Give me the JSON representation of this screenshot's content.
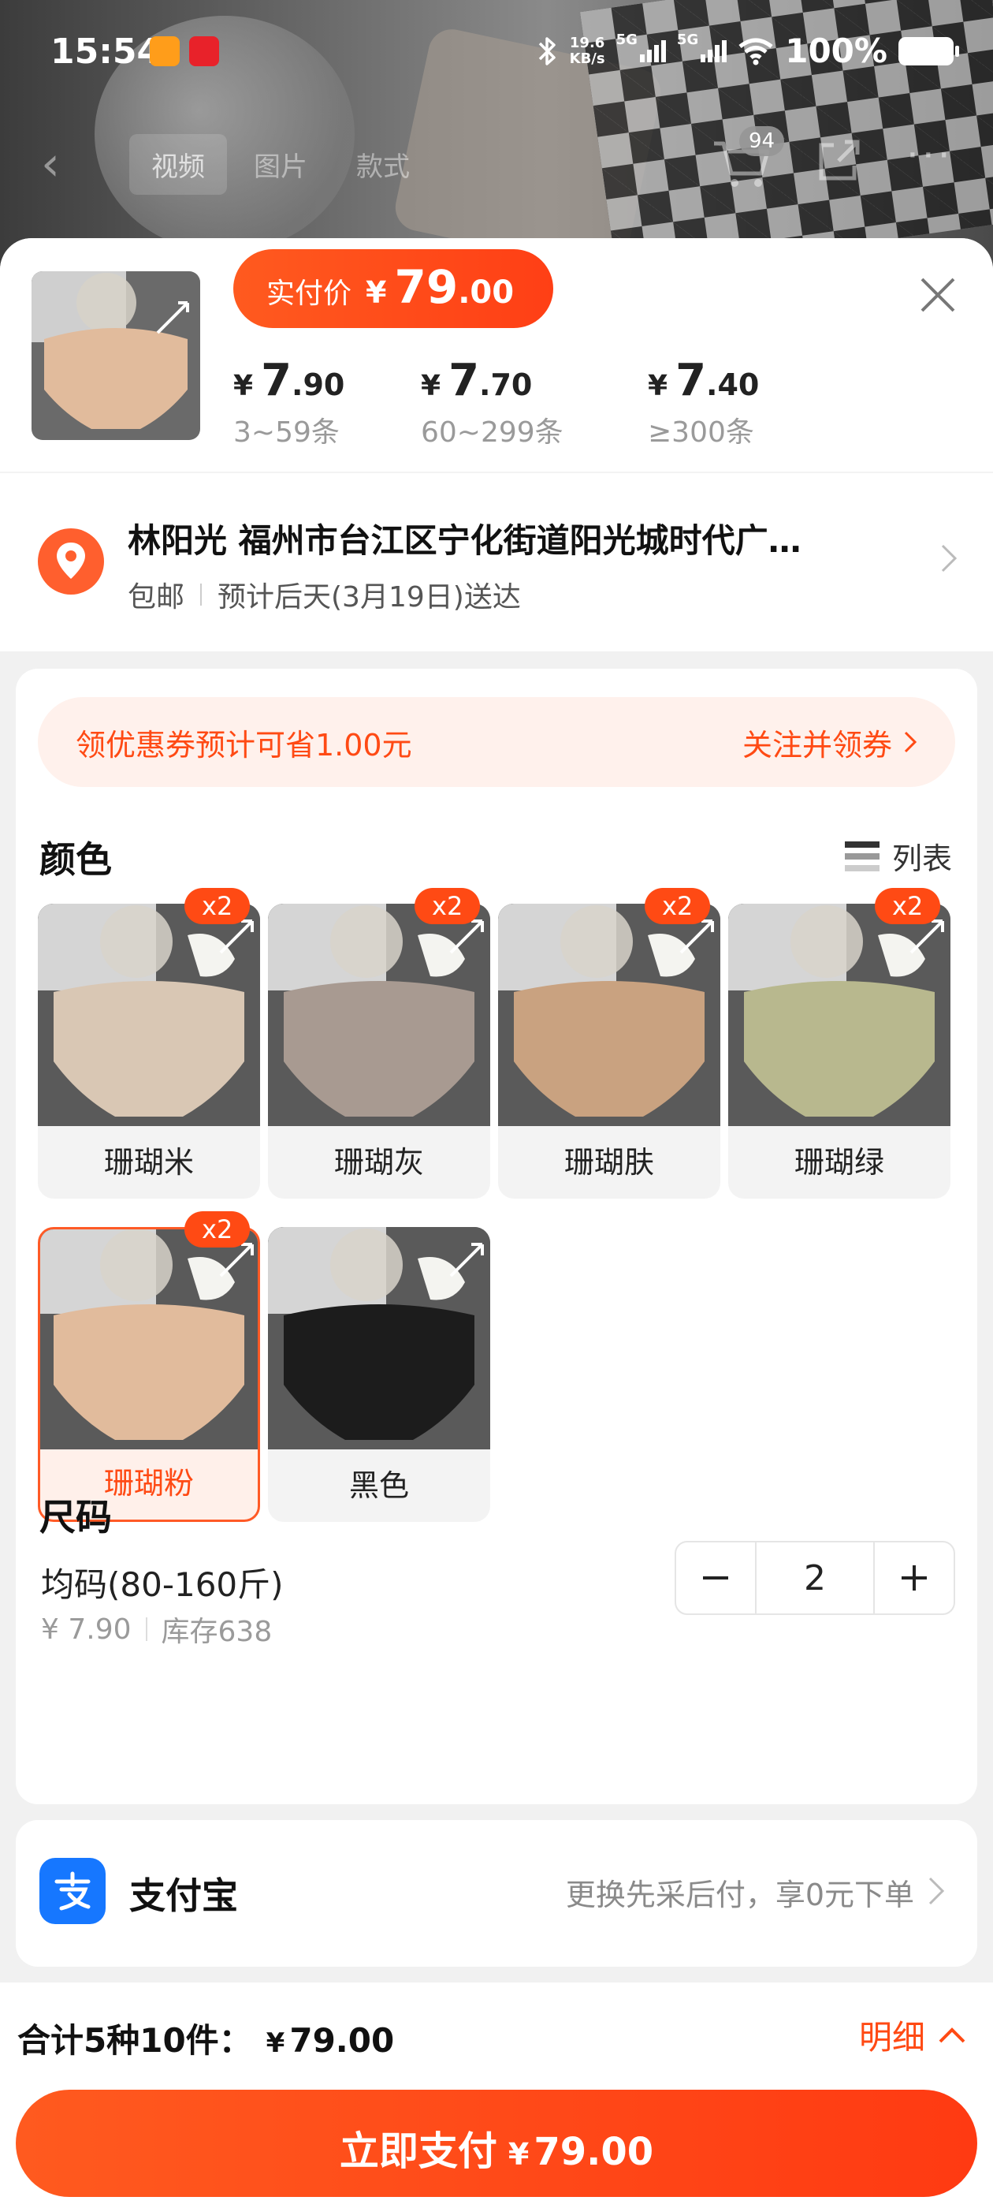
{
  "status_bar": {
    "time": "15:54",
    "net_speed_value": "19.6",
    "net_speed_unit": "KB/s",
    "sim1": "5G",
    "sim2": "5G",
    "battery": "100%"
  },
  "nav": {
    "tabs": [
      "视频",
      "图片",
      "款式"
    ],
    "cart_count": "94"
  },
  "price": {
    "actual_label": "实付价",
    "currency": "¥",
    "actual_int": "79",
    "actual_dec": ".00",
    "tiers": [
      {
        "int": "7",
        "dec": ".90",
        "qty": "3~59条"
      },
      {
        "int": "7",
        "dec": ".70",
        "qty": "60~299条"
      },
      {
        "int": "7",
        "dec": ".40",
        "qty": "≥300条"
      }
    ]
  },
  "address": {
    "line": "林阳光 福州市台江区宁化街道阳光城时代广…",
    "shipping": "包邮",
    "delivery": "预计后天(3月19日)送达"
  },
  "coupon": {
    "text": "领优惠券预计可省1.00元",
    "action": "关注并领券"
  },
  "colors": {
    "title": "颜色",
    "view_toggle": "列表",
    "items": [
      {
        "label": "珊瑚米",
        "badge": "x2",
        "swatch": "#d9c7b4"
      },
      {
        "label": "珊瑚灰",
        "badge": "x2",
        "swatch": "#a89a91"
      },
      {
        "label": "珊瑚肤",
        "badge": "x2",
        "swatch": "#c9a280"
      },
      {
        "label": "珊瑚绿",
        "badge": "x2",
        "swatch": "#b8b88e"
      },
      {
        "label": "珊瑚粉",
        "badge": "x2",
        "swatch": "#e1bb9c",
        "selected": true
      },
      {
        "label": "黑色",
        "badge": "",
        "swatch": "#1c1c1c"
      }
    ]
  },
  "size": {
    "title": "尺码",
    "name": "均码(80-160斤)",
    "price": "¥ 7.90",
    "stock": "库存638",
    "quantity": "2"
  },
  "payment": {
    "method": "支付宝",
    "promo": "更换先采后付，享0元下单"
  },
  "footer": {
    "total_label": "合计5种10件：",
    "total_currency": "¥",
    "total_amount": "79.00",
    "detail_label": "明细",
    "pay_label": "立即支付",
    "pay_currency": "¥",
    "pay_amount": "79.00"
  },
  "theme": {
    "accent": "#ff4a14",
    "alipay_blue": "#1677ff"
  }
}
